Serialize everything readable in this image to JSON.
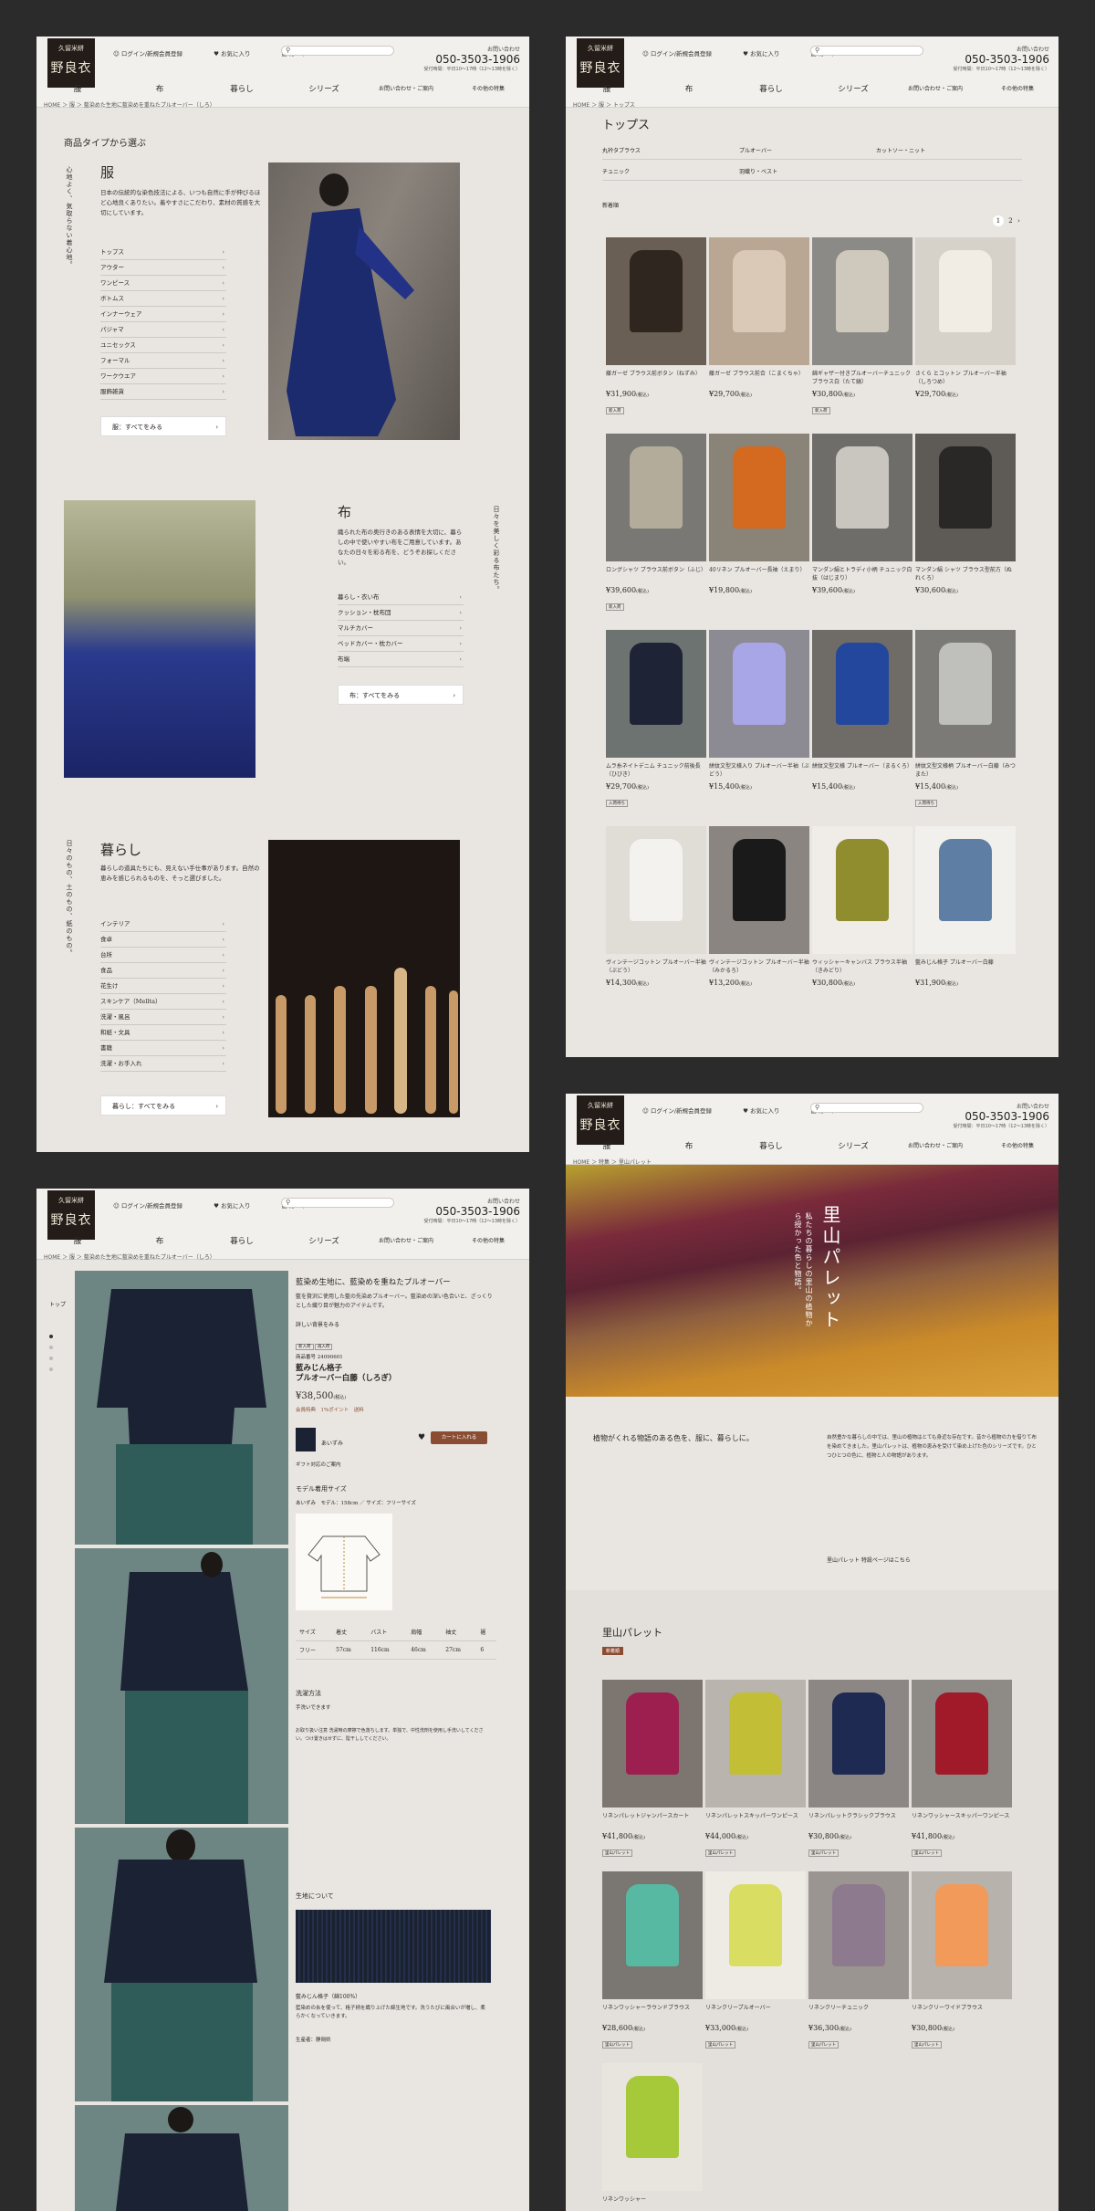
{
  "header": {
    "logo_top": "久留米絣",
    "logo_name": "野良衣",
    "links": [
      "ログイン/新規会員登録",
      "お気に入り",
      "カート"
    ],
    "tel_label": "お問い合わせ",
    "tel": "050-3503-1906",
    "hours": "受付時間：平日10〜17時（12〜13時を除く）",
    "nav": [
      "服",
      "布",
      "暮らし",
      "シリーズ",
      "お問い合わせ・ご案内",
      "その他の特集"
    ]
  },
  "panel1": {
    "breadcrumb": "HOME ＞ 服 ＞ 藍染めた生地に藍染めを重ねたプルオーバー（しろ）",
    "heading": "商品タイプから選ぶ",
    "clothes": {
      "title": "服",
      "vertical": "心地よく、気取らない着心地。",
      "desc": "日本の伝統的な染色技法による、いつも自然に手が伸びるほど心地良くありたい。着やすさにこだわり、素材の質感を大切にしています。",
      "items": [
        "トップス",
        "アウター",
        "ワンピース",
        "ボトムス",
        "インナーウェア",
        "パジャマ",
        "ユニセックス",
        "フォーマル",
        "ワークウエア",
        "服飾雑貨"
      ],
      "all": "服：すべてをみる"
    },
    "cloth": {
      "title": "布",
      "vertical": "日々を美しく彩る布たち。",
      "desc": "織られた布の奥行きのある表情を大切に、暮らしの中で使いやすい布をご用意しています。あなたの日々を彩る布を、どうぞお探しください。",
      "items": [
        "暮らし・衣い布",
        "クッション・枕布団",
        "マルチカバー",
        "ベッドカバー・枕カバー",
        "布端"
      ],
      "all": "布：すべてをみる"
    },
    "living": {
      "title": "暮らし",
      "vertical": "日々のもの、土のもの、紙のもの。",
      "desc": "暮らしの道具たちにも、見えない手仕事があります。自然の恵みを感じられるものを、そっと選びました。",
      "items": [
        "インテリア",
        "食卓",
        "台所",
        "食品",
        "花生け",
        "スキンケア（Mellta）",
        "洗濯・風呂",
        "和紙・文具",
        "書籍",
        "洗濯・お手入れ"
      ],
      "all": "暮らし：すべてをみる"
    }
  },
  "panel2": {
    "breadcrumb": "HOME ＞ 服 ＞ トップス",
    "title": "トップス",
    "subcats": [
      "丸衿タブラウス",
      "プルオーバー",
      "カットソー・ニット",
      "チュニック",
      "羽織り・ベスト"
    ],
    "sort": "新着順",
    "pages": [
      "1",
      "2",
      "›"
    ],
    "products": [
      {
        "name": "藤ガーゼ ブラウス前ボタン（ねずみ）",
        "price": "¥31,900",
        "tax": "(税込)",
        "tag": "新入荷"
      },
      {
        "name": "藤ガーゼ ブラウス前合（こまくちゃ）",
        "price": "¥29,700",
        "tax": "(税込)",
        "tag": ""
      },
      {
        "name": "綿ギャザー付きプルオーバーチュニック ブラウス白（たて縞）",
        "price": "¥30,800",
        "tax": "(税込)",
        "tag": "新入荷"
      },
      {
        "name": "さくら とコットン プルオーバー半袖（しろつめ）",
        "price": "¥29,700",
        "tax": "(税込)",
        "tag": ""
      },
      {
        "name": "ロングシャツ ブラウス前ボタン（ふじ）",
        "price": "¥39,600",
        "tax": "(税込)",
        "tag": "新入荷"
      },
      {
        "name": "40リネン プルオーバー長袖（えまり）",
        "price": "¥19,800",
        "tax": "(税込)",
        "tag": ""
      },
      {
        "name": "マンダン絹とトラディ小柄 チュニック白抜（はじまり）",
        "price": "¥39,600",
        "tax": "(税込)",
        "tag": ""
      },
      {
        "name": "マンダン絹 シャツ ブラウス型前方（ぬれくろ）",
        "price": "¥30,600",
        "tax": "(税込)",
        "tag": ""
      },
      {
        "name": "ムラ糸ネイトデニム チュニック前後長（ひびき）",
        "price": "¥29,700",
        "tax": "(税込)",
        "tag": "入荷待ち"
      },
      {
        "name": "絣紋文型文様入り プルオーバー半袖（ぶどう）",
        "price": "¥15,400",
        "tax": "(税込)",
        "tag": ""
      },
      {
        "name": "絣紋文型文様 プルオーバー（まるくろ）",
        "price": "¥15,400",
        "tax": "(税込)",
        "tag": ""
      },
      {
        "name": "絣紋文型文様柄 プルオーバー白藤（みつまた）",
        "price": "¥15,400",
        "tax": "(税込)",
        "tag": "入荷待ち"
      },
      {
        "name": "ヴィンテージコットン プルオーバー半袖（ぶどう）",
        "price": "¥14,300",
        "tax": "(税込)",
        "tag": ""
      },
      {
        "name": "ヴィンテージコットン プルオーバー半袖（みかるろ）",
        "price": "¥13,200",
        "tax": "(税込)",
        "tag": ""
      },
      {
        "name": "ウィッシャーキャンバス ブラウス半袖（きみどり）",
        "price": "¥30,800",
        "tax": "(税込)",
        "tag": ""
      },
      {
        "name": "藍みじん格子 プルオーバー白藤",
        "price": "¥31,900",
        "tax": "(税込)",
        "tag": ""
      }
    ]
  },
  "panel3": {
    "breadcrumb": "HOME ＞ 服 ＞ 藍染めた生地に藍染めを重ねたプルオーバー（しろ）",
    "side_label": "トップ",
    "headline": "藍染め生地に、藍染めを重ねたプルオーバー",
    "intro": "藍を贅沢に使用した藍の先染めプルオーバー。藍染めの深い色合いと、ざっくりとした織り目が魅力のアイテムです。",
    "more": "詳しい背景をみる",
    "tags": [
      "新入荷",
      "再入荷"
    ],
    "code": "商品番号 24090601",
    "product_title_1": "藍みじん格子",
    "product_title_2": "プルオーバー白藤（しろぎ）",
    "price": "¥38,500",
    "price_tax": "(税込)",
    "meta": "会員特典　1%ポイント　送料",
    "color": "あいずみ",
    "cart": "カートに入れる",
    "gift": "ギフト対応のご案内",
    "model_title": "モデル着用サイズ",
    "model_info": "あいずみ　モデル：158cm ／ サイズ：フリーサイズ",
    "size_head": [
      "サイズ",
      "着丈",
      "バスト",
      "肩幅",
      "袖丈",
      "裾"
    ],
    "size_row": [
      "フリー",
      "57cm",
      "116cm",
      "46cm",
      "27cm",
      "6"
    ],
    "wash_title": "洗濯方法",
    "wash": "手洗いできます",
    "care": "お取り扱い注意 洗濯時の摩擦で色落ちします。単独で、中性洗剤を使用し手洗いしてください。つけ置きはせずに、陰干ししてください。",
    "fabric_title": "生地について",
    "fabric_name": "藍みじん格子（綿100%）",
    "fabric_desc": "藍染めの糸を使って、格子柄を織り上げた綿生地です。洗うたびに風合いが増し、柔らかくなっていきます。",
    "maker": "生産者：静岡県"
  },
  "panel4": {
    "breadcrumb": "HOME ＞ 特集 ＞ 里山パレット",
    "hero_title": "里山パレット",
    "hero_sub": "私たちの暮らしの里山の植物から授かった色と物語。",
    "lead": "植物がくれる物語のある色を、服に、暮らしに。",
    "body": "自然豊かな暮らしの中では、里山の植物はとても身近な存在です。昔から植物の力を借りて布を染めてきました。里山パレットは、植物の恵みを受けて染め上げた色のシリーズです。ひとつひとつの色に、植物と人の物語があります。",
    "link": "里山パレット 特設ページはこちら",
    "section": "里山パレット",
    "badge": "新着順",
    "products": [
      {
        "name": "リネンパレットジャンパースカート",
        "price": "¥41,800",
        "tax": "(税込)",
        "tag": "里山パレット"
      },
      {
        "name": "リネンパレットスキッパーワンピース",
        "price": "¥44,000",
        "tax": "(税込)",
        "tag": "里山パレット"
      },
      {
        "name": "リネンパレットクラシックブラウス",
        "price": "¥30,800",
        "tax": "(税込)",
        "tag": "里山パレット"
      },
      {
        "name": "リネンワッシャースキッパーワンピース",
        "price": "¥41,800",
        "tax": "(税込)",
        "tag": "里山パレット"
      },
      {
        "name": "リネンワッシャーラウンドブラウス",
        "price": "¥28,600",
        "tax": "(税込)",
        "tag": "里山パレット"
      },
      {
        "name": "リネンクリープルオーバー",
        "price": "¥33,000",
        "tax": "(税込)",
        "tag": "里山パレット"
      },
      {
        "name": "リネンクリーチュニック",
        "price": "¥36,300",
        "tax": "(税込)",
        "tag": "里山パレット"
      },
      {
        "name": "リネンクリーワイドブラウス",
        "price": "¥30,800",
        "tax": "(税込)",
        "tag": "里山パレット"
      },
      {
        "name": "リネンワッシャー",
        "price": "",
        "tax": "",
        "tag": ""
      }
    ]
  },
  "colors": {
    "bg": "#2b2b2b",
    "panel": "#e9e6e1",
    "accent": "#8a4d33"
  }
}
